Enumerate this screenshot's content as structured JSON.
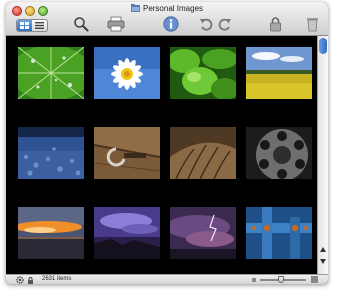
{
  "window": {
    "title": "Personal Images",
    "controls": [
      "close",
      "minimize",
      "zoom"
    ]
  },
  "toolbar": {
    "view_modes": [
      "grid-view",
      "list-view"
    ],
    "selected_view": "grid-view",
    "tools": [
      "search-icon",
      "print-icon",
      "info-icon",
      "rotate-left-icon",
      "rotate-right-icon",
      "lock-icon",
      "trash-icon"
    ]
  },
  "photos": [
    {
      "subject": "green leaf with water droplets"
    },
    {
      "subject": "white daisy against blue sky"
    },
    {
      "subject": "green plant sprouts"
    },
    {
      "subject": "yellow rapeseed field under sky"
    },
    {
      "subject": "blue pebbles close-up"
    },
    {
      "subject": "rusty hook on weathered wood"
    },
    {
      "subject": "cracked tree bark"
    },
    {
      "subject": "rotary phone dial"
    },
    {
      "subject": "orange sunset over sea"
    },
    {
      "subject": "purple stormy sky over coast"
    },
    {
      "subject": "purple clouds with lightning"
    },
    {
      "subject": "blue metal pipes with rusty bolts"
    }
  ],
  "status": {
    "item_count": "2631 items",
    "zoom_level": 0.45
  },
  "scrollbar": {
    "position": 0.0
  }
}
